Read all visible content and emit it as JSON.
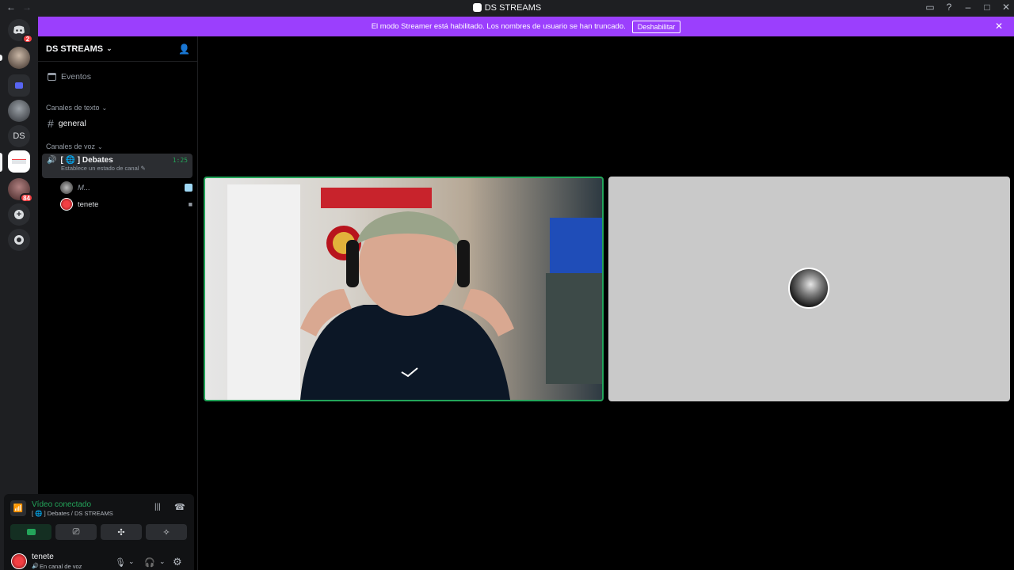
{
  "window": {
    "title": "DS STREAMS"
  },
  "banner": {
    "message": "El modo Streamer está habilitado. Los nombres de usuario se han truncado.",
    "button": "Deshabilitar"
  },
  "rail": {
    "home_badge": "2",
    "dm_badge": "84",
    "ds_label": "DS"
  },
  "sidebar": {
    "server_name": "DS STREAMS",
    "events": "Eventos",
    "text_category": "Canales de texto",
    "text_channel": "general",
    "voice_category": "Canales de voz",
    "voice_channel": "[ 🌐 ] Debates",
    "voice_timer": "1:25",
    "voice_status": "Establece un estado de canal",
    "members": [
      {
        "name": "M..."
      },
      {
        "name": "tenete"
      }
    ]
  },
  "voice_panel": {
    "status": "Vídeo conectado",
    "location": "[ 🌐 ] Debates / DS STREAMS",
    "user_name": "tenete",
    "user_status": "En canal de voz"
  },
  "colors": {
    "banner": "#9b3ffd",
    "connected": "#23a55a",
    "speaking_border": "#23a55a"
  }
}
